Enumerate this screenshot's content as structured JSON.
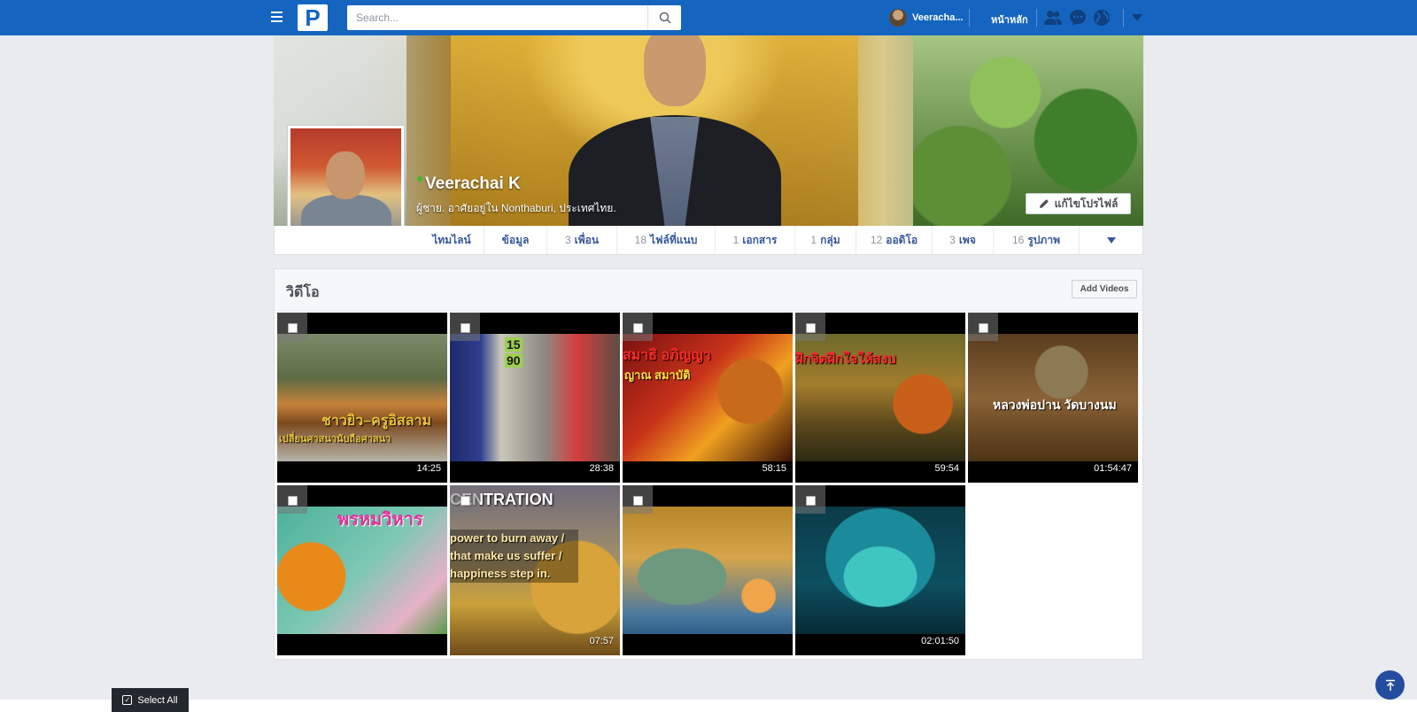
{
  "topbar": {
    "logo_letter": "P",
    "search_placeholder": "Search...",
    "user_name": "Veeracha...",
    "home_label": "หน้าหลัก",
    "icons": [
      "friends-icon",
      "messages-icon",
      "globe-icon",
      "caret-down-icon"
    ],
    "accent": "#1565c0"
  },
  "profile": {
    "name": "Veerachai K",
    "subtitle": "ผู้ชาย. อาศัยอยู่ใน Nonthaburi,  ประเทศไทย.",
    "edit_label": "แก้ไขโปรไฟล์",
    "online": true
  },
  "tabs": [
    {
      "count": "",
      "label": "ไทมไลน์"
    },
    {
      "count": "",
      "label": "ข้อมูล"
    },
    {
      "count": "3",
      "label": "เพื่อน"
    },
    {
      "count": "18",
      "label": "ไฟล์ที่แนบ"
    },
    {
      "count": "1",
      "label": "เอกสาร"
    },
    {
      "count": "1",
      "label": "กลุ่ม"
    },
    {
      "count": "12",
      "label": "ออดิโอ"
    },
    {
      "count": "3",
      "label": "เพจ"
    },
    {
      "count": "16",
      "label": "รูปภาพ"
    }
  ],
  "videos": {
    "title": "วิดีโอ",
    "add_label": "Add Videos",
    "items": [
      {
        "duration": "14:25",
        "caption": "ชาวยิว–ครูอิสลาม",
        "caption2": "เปลี่ยนศาสนานับถือศาสนา"
      },
      {
        "duration": "28:38",
        "caption": "15",
        "caption2": "90"
      },
      {
        "duration": "58:15",
        "caption": "สมาธิ อภิญญา",
        "caption2": "ญาณ สมาบัติ"
      },
      {
        "duration": "59:54",
        "caption": "ฝึกจิตฝึกใจให้สงบ",
        "caption2": ""
      },
      {
        "duration": "01:54:47",
        "caption": "หลวงพ่อปาน วัดบางนม",
        "caption2": ""
      },
      {
        "duration": "",
        "caption": "พรหมวิหาร",
        "caption2": ""
      },
      {
        "duration": "07:57",
        "caption": "CENTRATION",
        "caption2": "power to burn away / that make us suffer / happiness step in."
      },
      {
        "duration": "",
        "caption": "",
        "caption2": ""
      },
      {
        "duration": "02:01:50",
        "caption": "",
        "caption2": ""
      }
    ]
  },
  "footer": {
    "select_all_label": "Select All"
  }
}
